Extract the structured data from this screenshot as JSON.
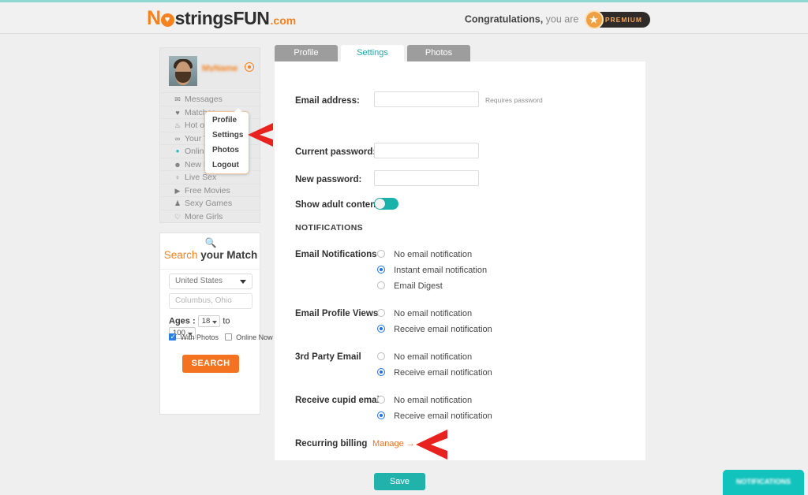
{
  "header": {
    "logo": {
      "part1": "N",
      "part2": "stringsFUN",
      "part3": ".com",
      "heart_icon": "heart-icon"
    },
    "congrats_bold": "Congratulations,",
    "congrats_rest": "you are",
    "premium_label": "PREMIUM",
    "star_icon": "★"
  },
  "profile": {
    "username": "MyName",
    "gear_icon": "gear-icon",
    "nav": [
      {
        "label": "Messages",
        "icon": "✉"
      },
      {
        "label": "Matches",
        "icon": "♥"
      },
      {
        "label": "Hot or Not",
        "icon": "♨"
      },
      {
        "label": "Your Views",
        "icon": "∞"
      },
      {
        "label": "Online",
        "icon": "•"
      },
      {
        "label": "New Members",
        "icon": "☻"
      },
      {
        "label": "Live Sex",
        "icon": "♀"
      },
      {
        "label": "Free Movies",
        "icon": "▶"
      },
      {
        "label": "Sexy Games",
        "icon": "♟"
      },
      {
        "label": "More Girls",
        "icon": "♡"
      }
    ]
  },
  "dropdown": {
    "items": [
      "Profile",
      "Settings",
      "Photos",
      "Logout"
    ]
  },
  "search": {
    "title_orange": "Search",
    "title_dark": "your Match",
    "magnifier_icon": "search-icon",
    "country_value": "United States",
    "city_placeholder": "Columbus, Ohio",
    "ages_label": "Ages :",
    "age_min": "18",
    "ages_to": "to",
    "age_max": "100",
    "with_photos": "With Photos",
    "online_now": "Online Now",
    "search_button": "SEARCH"
  },
  "tabs": [
    {
      "label": "Profile",
      "active": false
    },
    {
      "label": "Settings",
      "active": true
    },
    {
      "label": "Photos",
      "active": false
    }
  ],
  "settings": {
    "email_label": "Email address:",
    "email_value": "",
    "email_hint": "Requires password",
    "current_password_label": "Current password:",
    "current_password_value": "",
    "new_password_label": "New password:",
    "new_password_value": "",
    "adult_label": "Show adult content",
    "adult_toggle_state": "on",
    "notifications_head": "NOTIFICATIONS",
    "groups": [
      {
        "label": "Email Notifications",
        "options": [
          "No email notification",
          "Instant email notification",
          "Email Digest"
        ],
        "selected": 1
      },
      {
        "label": "Email Profile Views",
        "options": [
          "No email notification",
          "Receive email notification"
        ],
        "selected": 1
      },
      {
        "label": "3rd Party Email",
        "options": [
          "No email notification",
          "Receive email notification"
        ],
        "selected": 1
      },
      {
        "label": "Receive cupid email",
        "options": [
          "No email notification",
          "Receive email notification"
        ],
        "selected": 1
      }
    ],
    "billing_label": "Recurring billing",
    "billing_link": "Manage →",
    "save_label": "Save"
  },
  "chat_widget": {
    "label": "NOTIFICATIONS"
  },
  "colors": {
    "orange": "#f58220",
    "teal": "#18b2aa",
    "blue_radio": "#1a73e8",
    "annotation_red": "#e8231f"
  }
}
